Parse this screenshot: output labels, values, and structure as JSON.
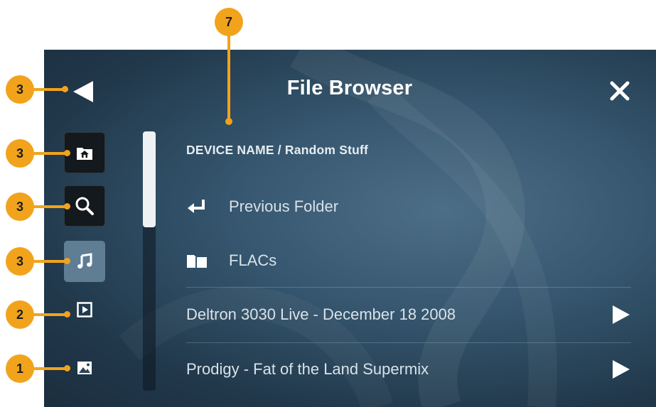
{
  "screen": {
    "title": "File Browser",
    "breadcrumb": "DEVICE NAME / Random Stuff",
    "back_icon": "back-triangle-icon",
    "close_icon": "close-x-icon"
  },
  "sidebar": {
    "items": [
      {
        "name": "home",
        "icon": "home-folder-icon",
        "state": "dark"
      },
      {
        "name": "search",
        "icon": "search-icon",
        "state": "dark"
      },
      {
        "name": "music",
        "icon": "music-note-icon",
        "state": "active"
      },
      {
        "name": "video",
        "icon": "video-play-icon",
        "state": "plain"
      },
      {
        "name": "photos",
        "icon": "image-icon",
        "state": "plain"
      }
    ]
  },
  "list": {
    "items": [
      {
        "type": "up",
        "label": "Previous Folder",
        "icon": "return-arrow-icon"
      },
      {
        "type": "folder",
        "label": "FLACs",
        "icon": "folder-icon"
      },
      {
        "type": "track",
        "label": "Deltron 3030 Live - December 18 2008",
        "icon": "play-icon"
      },
      {
        "type": "track",
        "label": "Prodigy - Fat of the Land Supermix",
        "icon": "play-icon"
      }
    ]
  },
  "callouts": {
    "top": "7",
    "back": "3",
    "home": "3",
    "search": "3",
    "music": "3",
    "video": "2",
    "photos": "1"
  },
  "colors": {
    "accent_badge": "#f2a31c",
    "screen_bg": "#35566e",
    "text": "#ffffff"
  }
}
